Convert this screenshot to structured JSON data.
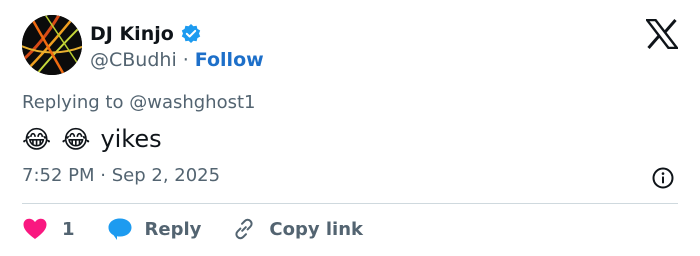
{
  "author": {
    "display_name": "DJ Kinjo",
    "handle": "@CBudhi",
    "separator": "·",
    "follow_label": "Follow",
    "verified": true
  },
  "reply_context": {
    "prefix": "Replying to",
    "mention": "@washghost1"
  },
  "tweet": {
    "emojis": [
      "😂",
      "😂"
    ],
    "text": "yikes"
  },
  "meta": {
    "time": "7:52 PM",
    "separator": "·",
    "date": "Sep 2, 2025"
  },
  "actions": {
    "like_count": "1",
    "reply_label": "Reply",
    "copy_label": "Copy link"
  },
  "colors": {
    "accent": "#1d9bf0",
    "follow": "#1d6fc9",
    "like": "#f91880",
    "muted": "#536471"
  },
  "icons": {
    "verified": "verified-badge-icon",
    "brand": "x-logo-icon",
    "info": "info-icon",
    "like": "heart-icon",
    "reply": "speech-bubble-icon",
    "copy": "link-icon"
  }
}
